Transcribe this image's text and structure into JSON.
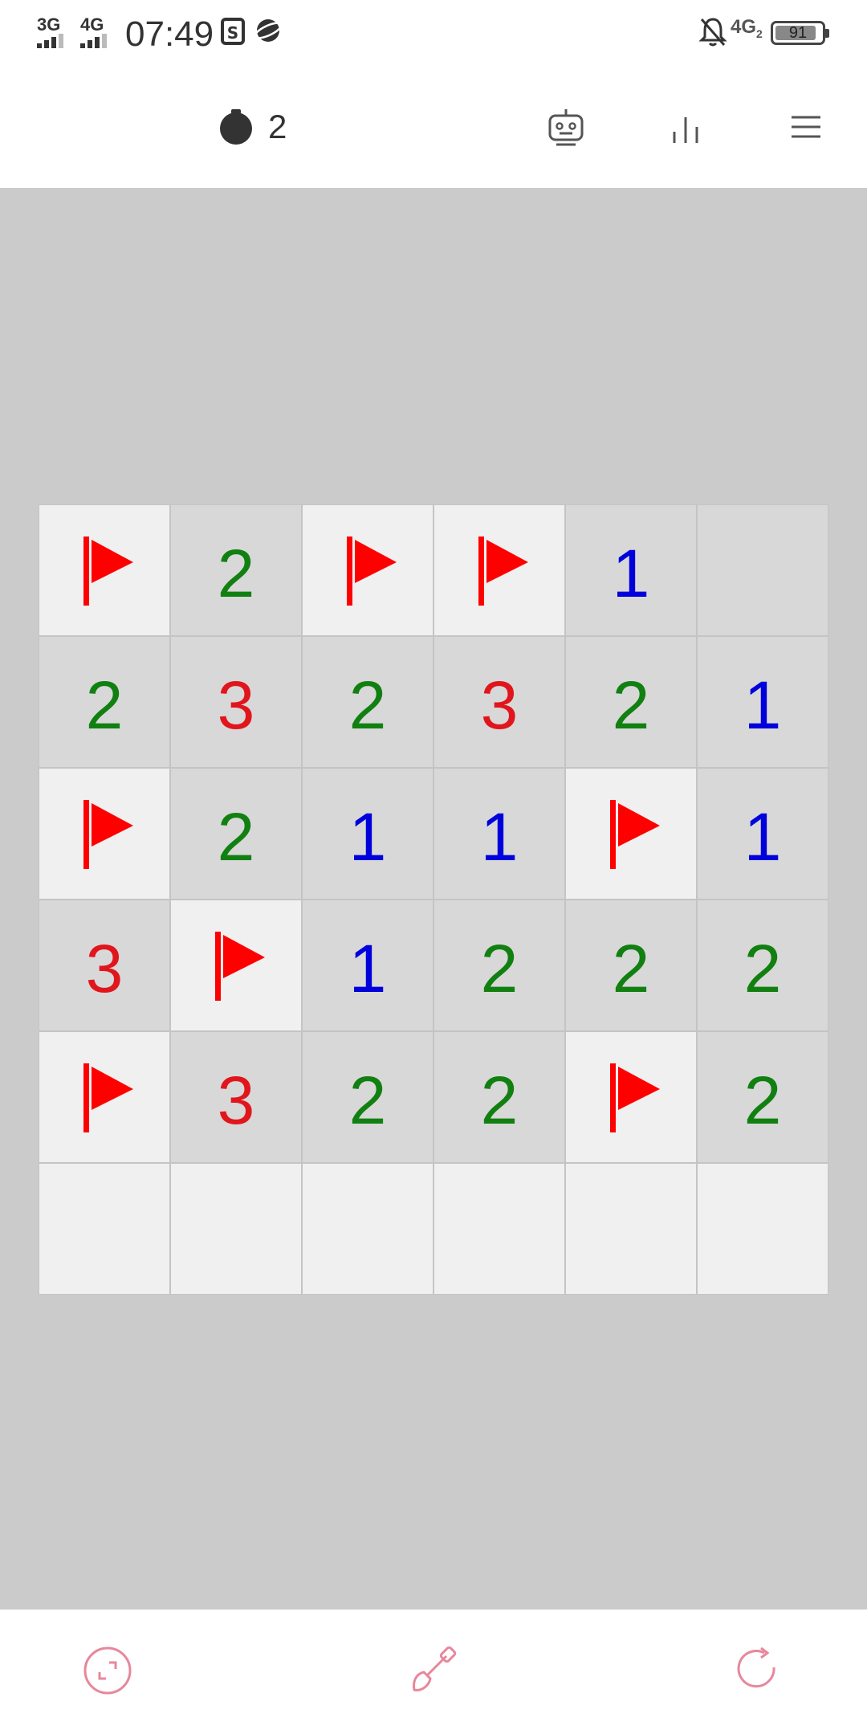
{
  "status_bar": {
    "network_1": "3G",
    "network_2": "4G",
    "time": "07:49",
    "network_3": "4G",
    "network_3_sub": "2",
    "battery": "91",
    "icons": [
      "screenshot-icon",
      "browser-icon",
      "bell-off-icon"
    ]
  },
  "toolbar": {
    "mines_remaining": "2",
    "icons": [
      "mine-icon",
      "robot-icon",
      "stats-icon",
      "menu-icon"
    ]
  },
  "colors": {
    "one": "#0000dd",
    "two": "#118011",
    "three": "#e0161c",
    "flag": "#ff0000",
    "open_cell": "#d8d8d8",
    "hidden_cell": "#f0f0f0",
    "board_background": "#cbcbcb",
    "accent": "#e8879b"
  },
  "board": {
    "rows": [
      [
        "F",
        "2",
        "F",
        "F",
        "1",
        ""
      ],
      [
        "2",
        "3",
        "2",
        "3",
        "2",
        "1"
      ],
      [
        "F",
        "2",
        "1",
        "1",
        "F",
        "1"
      ],
      [
        "3",
        "F",
        "1",
        "2",
        "2",
        "2"
      ],
      [
        "F",
        "3",
        "2",
        "2",
        "F",
        "2"
      ],
      [
        "H",
        "H",
        "H",
        "H",
        "H",
        "H"
      ]
    ],
    "legend": {
      "F": "flagged",
      "H": "unrevealed",
      "": "revealed-empty"
    }
  },
  "bottom_bar": {
    "icons": [
      "fullscreen-icon",
      "shovel-icon",
      "restart-icon"
    ]
  }
}
